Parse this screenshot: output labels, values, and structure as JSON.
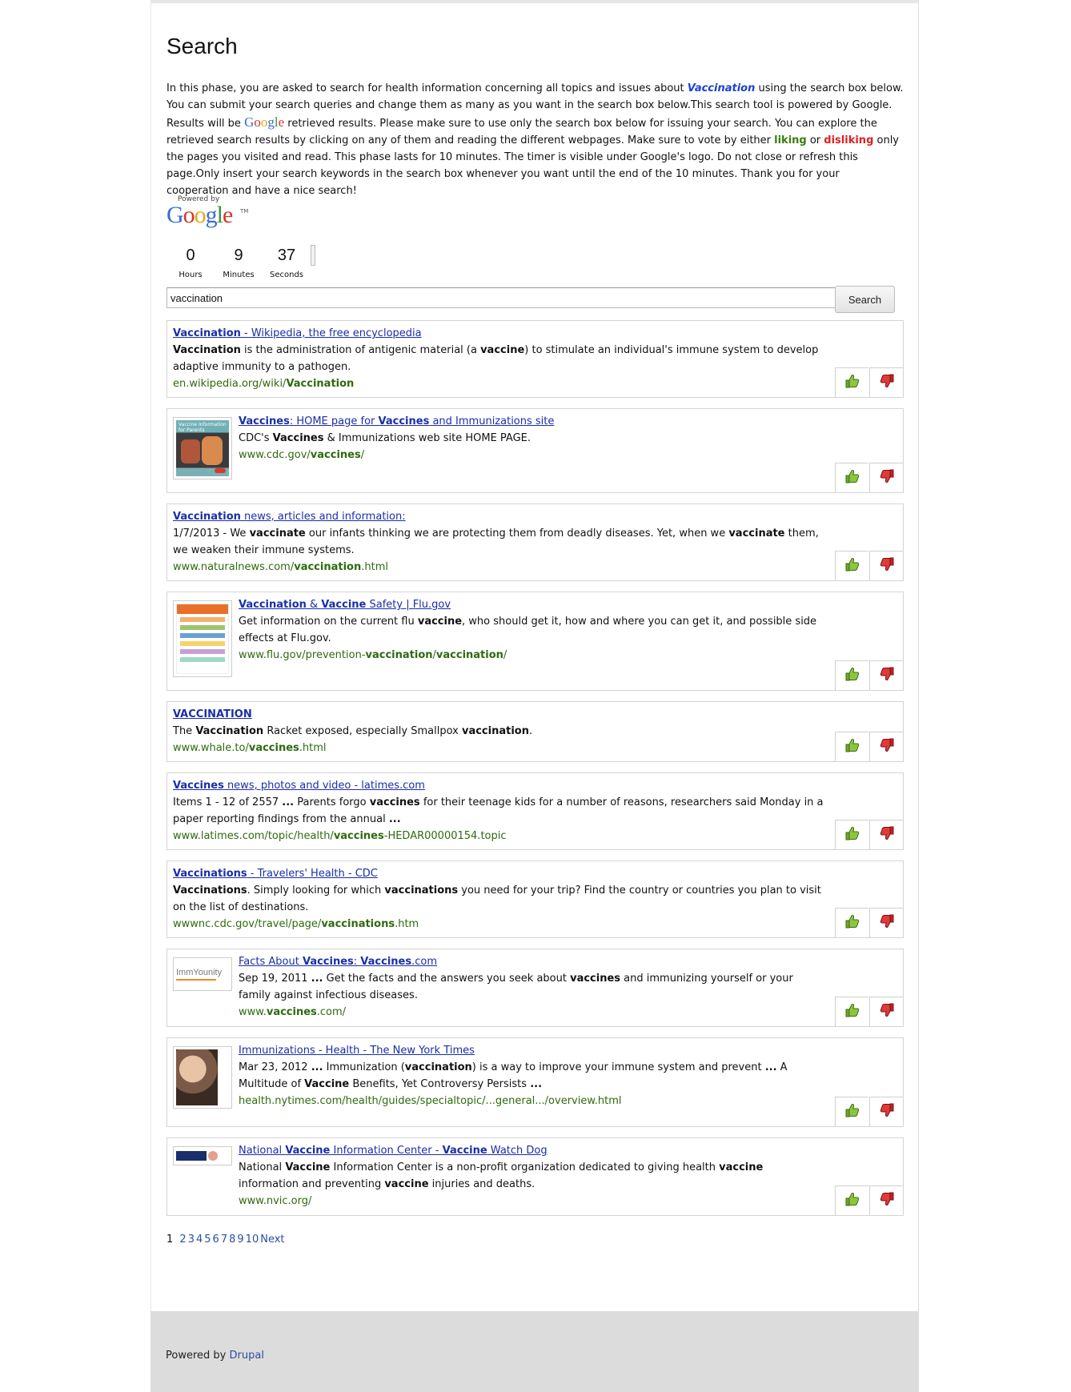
{
  "page": {
    "title": "Search",
    "intro_parts": {
      "p1": "In this phase, you are asked to search for health information concerning all topics and issues about ",
      "topic": "Vaccination",
      "p2": " using the search box below. You can submit your search queries and change them as many as you want in the search box below.This search tool is powered by Google. Results will be ",
      "google_word": "Google",
      "p3": " retrieved results. Please make sure to use only the search box below for issuing your search. You can explore the retrieved search results by clicking on any of them and reading the different webpages. Make sure to vote by either ",
      "liking": "liking",
      "p4": " or ",
      "disliking": "disliking",
      "p5": " only the pages you visited and read. This phase lasts for 10 minutes. The timer is visible under Google's logo. Do not close or refresh this page.Only insert your search keywords in the search box whenever you want until the end of the 10 minutes. Thank you for your cooperation and have a nice search!"
    }
  },
  "powered_by": {
    "label": "Powered by",
    "brand": "Google",
    "tm": "TM"
  },
  "timer": {
    "hours": "0",
    "hours_label": "Hours",
    "minutes": "9",
    "minutes_label": "Minutes",
    "seconds": "37",
    "seconds_label": "Seconds"
  },
  "search": {
    "query": "vaccination",
    "button_label": "Search"
  },
  "icons": {
    "like": "thumbs-up-icon",
    "dislike": "thumbs-down-icon"
  },
  "colors": {
    "link": "#1a2ea8",
    "url": "#2e6a0e",
    "like": "#3a7d0e",
    "dislike": "#e01f1f",
    "footer_bg": "#dcdcdc"
  },
  "results": [
    {
      "title_html": "<b>Vaccination</b> - Wikipedia, the free encyclopedia",
      "snippet_html": "<b>Vaccination</b> is the administration of antigenic material (a <b>vaccine</b>) to stimulate an individual's immune system to develop adaptive immunity to a pathogen.",
      "url_html": "en.wikipedia.org/wiki/<b>Vaccination</b>",
      "thumb": ""
    },
    {
      "title_html": "<b>Vaccines</b>: HOME page for <b>Vaccines</b> and Immunizations site",
      "snippet_html": "CDC's <b>Vaccines</b> &amp; Immunizations web site HOME PAGE.",
      "url_html": "www.cdc.gov/<b>vaccines</b>/",
      "thumb": "cdc",
      "thumb_text": "Vaccine Information for Parents"
    },
    {
      "title_html": "<b>Vaccination</b> news, articles and information:",
      "snippet_html": "1/7/2013 - We <b>vaccinate</b> our infants thinking we are protecting them from deadly diseases. Yet, when we <b>vaccinate</b> them, we weaken their immune systems.",
      "url_html": "www.naturalnews.com/<b>vaccination</b>.html",
      "thumb": ""
    },
    {
      "title_html": "<b>Vaccination</b> &amp; <b>Vaccine</b> Safety | Flu.gov",
      "snippet_html": "Get information on the current flu <b>vaccine</b>, who should get it, how and where you can get it, and possible side effects at Flu.gov.",
      "url_html": "www.flu.gov/prevention-<b>vaccination</b>/<b>vaccination</b>/",
      "thumb": "flu"
    },
    {
      "title_html": "<b>VACCINATION</b>",
      "snippet_html": "The <b>Vaccination</b> Racket exposed, especially Smallpox <b>vaccination</b>.",
      "url_html": "www.whale.to/<b>vaccines</b>.html",
      "thumb": ""
    },
    {
      "title_html": "<b>Vaccines</b> news, photos and video - latimes.com",
      "snippet_html": "Items 1 - 12 of 2557 <b>...</b> Parents forgo <b>vaccines</b> for their teenage kids for a number of reasons, researchers said Monday in a paper reporting findings from the annual <b>...</b>",
      "url_html": "www.latimes.com/topic/health/<b>vaccines</b>-HEDAR00000154.topic",
      "thumb": ""
    },
    {
      "title_html": "<b>Vaccinations</b> - Travelers' Health - CDC",
      "snippet_html": "<b>Vaccinations</b>. Simply looking for which <b>vaccinations</b> you need for your trip? Find the country or countries you plan to visit on the list of destinations.",
      "url_html": "wwwnc.cdc.gov/travel/page/<b>vaccinations</b>.htm",
      "thumb": ""
    },
    {
      "title_html": "Facts About <b>Vaccines</b>: <b>Vaccines</b>.com",
      "snippet_html": "Sep 19, 2011 <b>...</b> Get the facts and the answers you seek about <b>vaccines</b> and immunizing yourself or your family against infectious diseases.",
      "url_html": "www.<b>vaccines</b>.com/",
      "thumb": "immyounity",
      "thumb_text": "ImmYounity"
    },
    {
      "title_html": "Immunizations - Health - The New York Times",
      "snippet_html": "Mar 23, 2012 <b>...</b> Immunization (<b>vaccination</b>) is a way to improve your immune system and prevent <b>...</b> A Multitude of <b>Vaccine</b> Benefits, Yet Controversy Persists <b>...</b>",
      "url_html": "health.nytimes.com/health/guides/specialtopic/...general.../overview.html",
      "thumb": "nyt"
    },
    {
      "title_html": "National <b>Vaccine</b> Information Center - <b>Vaccine</b> Watch Dog",
      "snippet_html": "National <b>Vaccine</b> Information Center is a non-profit organization dedicated to giving health <b>vaccine</b> information and preventing <b>vaccine</b> injuries and deaths.",
      "url_html": "www.nvic.org/",
      "thumb": "nvic"
    }
  ],
  "pager": {
    "current": "1",
    "pages": [
      "2",
      "3",
      "4",
      "5",
      "6",
      "7",
      "8",
      "9",
      "10"
    ],
    "next": "Next"
  },
  "footer": {
    "label": "Powered by",
    "link": "Drupal"
  }
}
